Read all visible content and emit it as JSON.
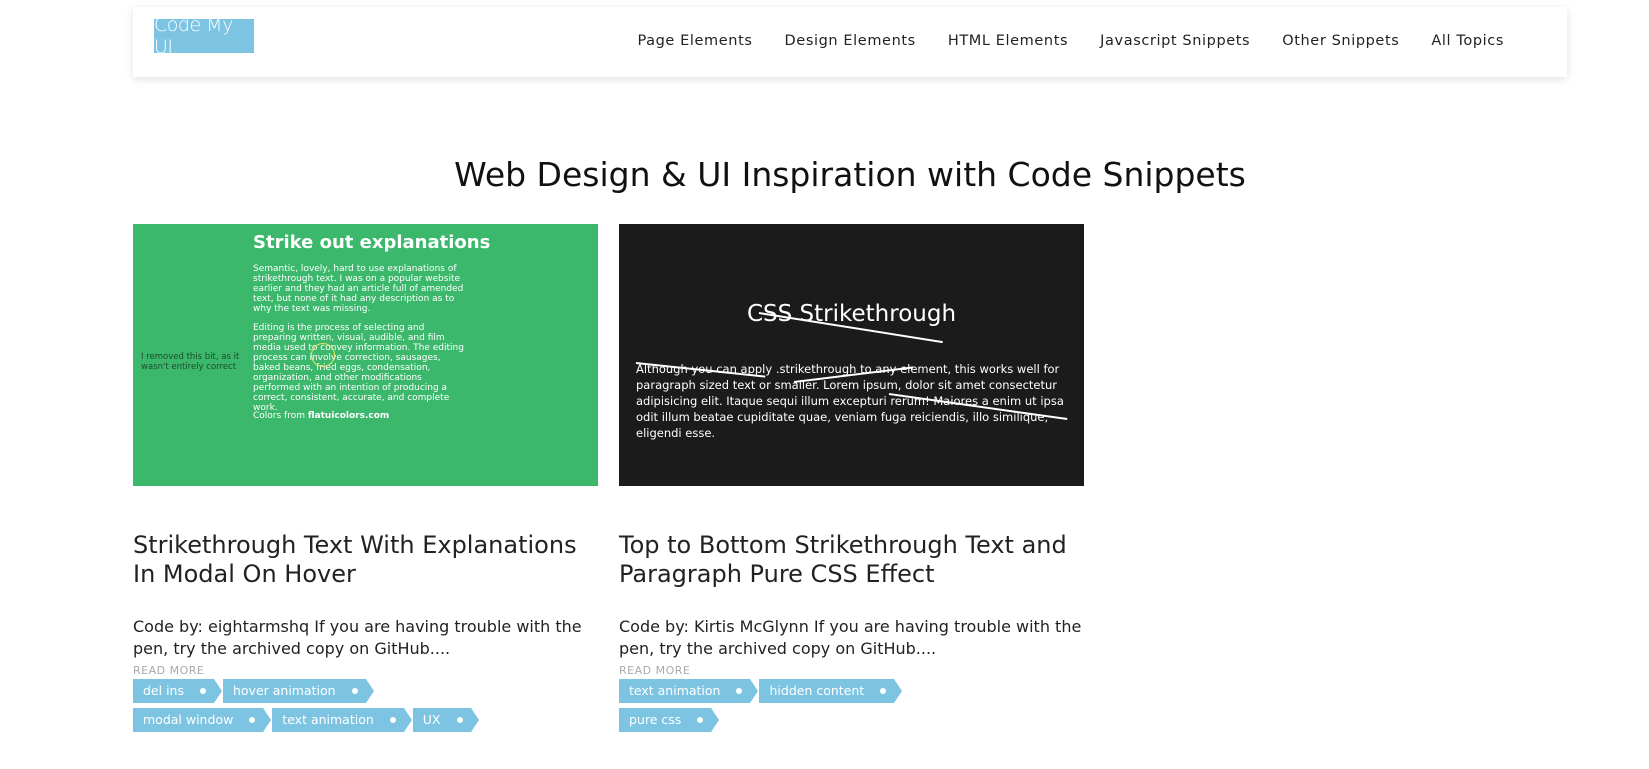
{
  "header": {
    "logo": "Code My UI",
    "nav": [
      "Page Elements",
      "Design Elements",
      "HTML Elements",
      "Javascript Snippets",
      "Other Snippets",
      "All Topics"
    ]
  },
  "page_title": "Web Design & UI Inspiration with Code Snippets",
  "colors": {
    "accent": "#7cc4e2",
    "thumb_green": "#3bb86c",
    "thumb_dark": "#1b1b1b"
  },
  "cards": [
    {
      "thumb": {
        "title": "Strike out explanations",
        "p1": "Semantic, lovely, hard to use explanations of strikethrough text. I was on a popular website earlier and they had an article full of amended text, but none of it had any description as to why the text was missing.",
        "p2": "Editing is the process of selecting and preparing written, visual, audible, and film media used to convey information. The editing process can involve correction, sausages, baked beans, fried eggs, condensation, organization, and other modifications performed with an intention of producing a correct, consistent, accurate, and complete work.",
        "colors_prefix": "Colors from ",
        "colors_link": "flatuicolors.com",
        "side_note": "I removed this bit, as it wasn't entirely correct"
      },
      "title": "Strikethrough Text With Explanations In Modal On Hover",
      "desc": "Code by: eightarmshq If you are having trouble with the pen, try the archived copy on GitHub....",
      "read_more": "READ MORE",
      "tags": [
        "del ins",
        "hover animation",
        "modal window",
        "text animation",
        "UX"
      ]
    },
    {
      "thumb": {
        "title": "CSS Strikethrough",
        "p1": "Although you can apply .strikethrough to any element, this works well for paragraph sized text or smaller. Lorem ipsum, dolor sit amet consectetur adipisicing elit. Itaque sequi illum excepturi rerum! Maiores a enim ut ipsa odit illum beatae cupiditate quae, veniam fuga reiciendis, illo similique, eligendi esse."
      },
      "title": "Top to Bottom Strikethrough Text and Paragraph Pure CSS Effect",
      "desc": "Code by: Kirtis McGlynn If you are having trouble with the pen, try the archived copy on GitHub....",
      "read_more": "READ MORE",
      "tags": [
        "text animation",
        "hidden content",
        "pure css"
      ]
    }
  ]
}
